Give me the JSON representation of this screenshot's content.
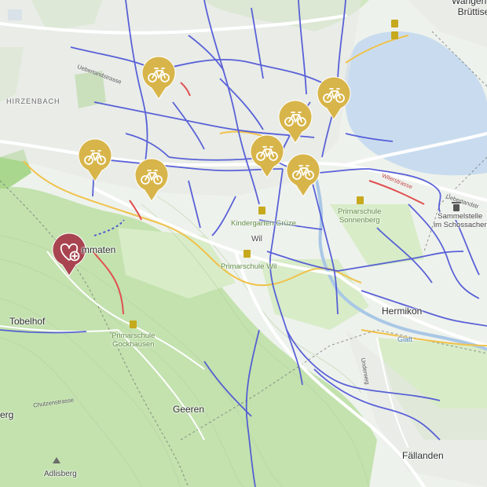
{
  "map": {
    "places": {
      "wangen_bruettisellen": "Wangen-\nBrüttise",
      "hirzenbach": "HIRZENBACH",
      "tobelhof": "Tobelhof",
      "geeren": "Geeren",
      "hermikon": "Hermikon",
      "faellanden": "Fällanden",
      "adlisberg": "Adlisberg",
      "stettbach_partial": "erg",
      "dietlikon_partial": "mmaten",
      "wil": "Wil"
    },
    "pois": {
      "kindergarten_gruze": "Kindergarten Grüze",
      "primarschule_wil": "Primarschule Wil",
      "primarschule_sonnenberg": "Primarschule\nSonnenberg",
      "primarschule_gockhausen": "Primarschule\nGockhausen",
      "sammelstelle": "Sammelstelle\nim Schossacher"
    },
    "streets": {
      "uebertandstrasse": "Uebertandstrasse",
      "uebertandstr_e": "Uebertandstr",
      "chutzenstrasse": "Chutzenstrasse",
      "wilerstrasse": "Wilerstrasse",
      "glatt": "Glatt",
      "underweg": "Underweg"
    },
    "markers": [
      {
        "type": "bike-station",
        "icon": "bicycle-icon",
        "color": "#d8b54a"
      },
      {
        "type": "bike-station",
        "icon": "bicycle-icon",
        "color": "#d8b54a"
      },
      {
        "type": "bike-station",
        "icon": "bicycle-icon",
        "color": "#d8b54a"
      },
      {
        "type": "bike-station",
        "icon": "bicycle-icon",
        "color": "#d8b54a"
      },
      {
        "type": "bike-station",
        "icon": "bicycle-icon",
        "color": "#d8b54a"
      },
      {
        "type": "bike-station",
        "icon": "bicycle-icon",
        "color": "#d8b54a"
      },
      {
        "type": "bike-station",
        "icon": "bicycle-icon",
        "color": "#d8b54a"
      },
      {
        "type": "bike-station",
        "icon": "bicycle-icon",
        "color": "#d8b54a"
      },
      {
        "type": "health",
        "icon": "heart-plus-icon",
        "color": "#a84550"
      }
    ],
    "colors": {
      "bike_route": "#4a52d6",
      "road_yellow": "#f0c24a",
      "road_red": "#e05050",
      "water": "#c9dcef",
      "forest": "#bfe0a8"
    }
  }
}
